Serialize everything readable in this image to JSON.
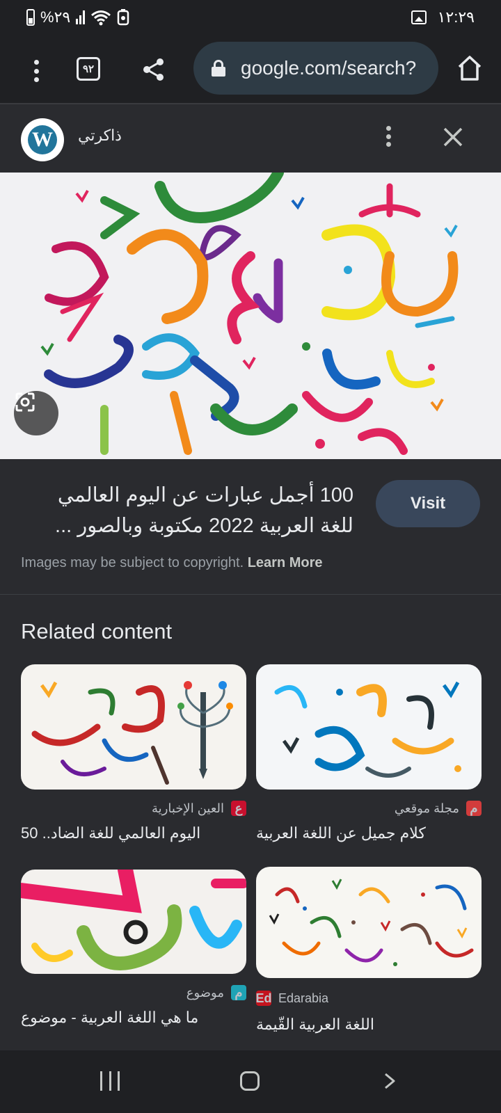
{
  "status_bar": {
    "battery": "%٢٩",
    "time": "١٢:٢٩"
  },
  "toolbar": {
    "tab_count": "٩٢",
    "url": "google.com/search?"
  },
  "panel": {
    "source_name": "ذاكرتي",
    "source_logo_letter": "W",
    "result_title": "100 أجمل عبارات عن اليوم العالمي للغة العربية 2022 مكتوبة وبالصور ...",
    "visit_label": "Visit",
    "copyright_text": "Images may be subject to copyright.",
    "learn_more": "Learn More"
  },
  "related": {
    "heading": "Related content",
    "cards": [
      {
        "source": "العين الإخبارية",
        "caption": "اليوم العالمي للغة الضاد.. 50",
        "favicon_text": "ع",
        "favicon_color": "#c8102e"
      },
      {
        "source": "مجلة موقعي",
        "caption": "كلام جميل عن اللغة العربية",
        "favicon_text": "م",
        "favicon_color": "#d23c3c"
      },
      {
        "source": "موضوع",
        "caption": "ما هي اللغة العربية - موضوع",
        "favicon_text": "م",
        "favicon_color": "#1fa3b5"
      },
      {
        "source": "Edarabia",
        "caption": "اللغة العربية القّيمة",
        "favicon_text": "Ed",
        "favicon_color": "#c4141e"
      }
    ]
  },
  "colors": {
    "background": "#1f2023",
    "panel": "#2a2b2f",
    "omnibox": "#2e3b45",
    "visit_button": "#39475b"
  }
}
